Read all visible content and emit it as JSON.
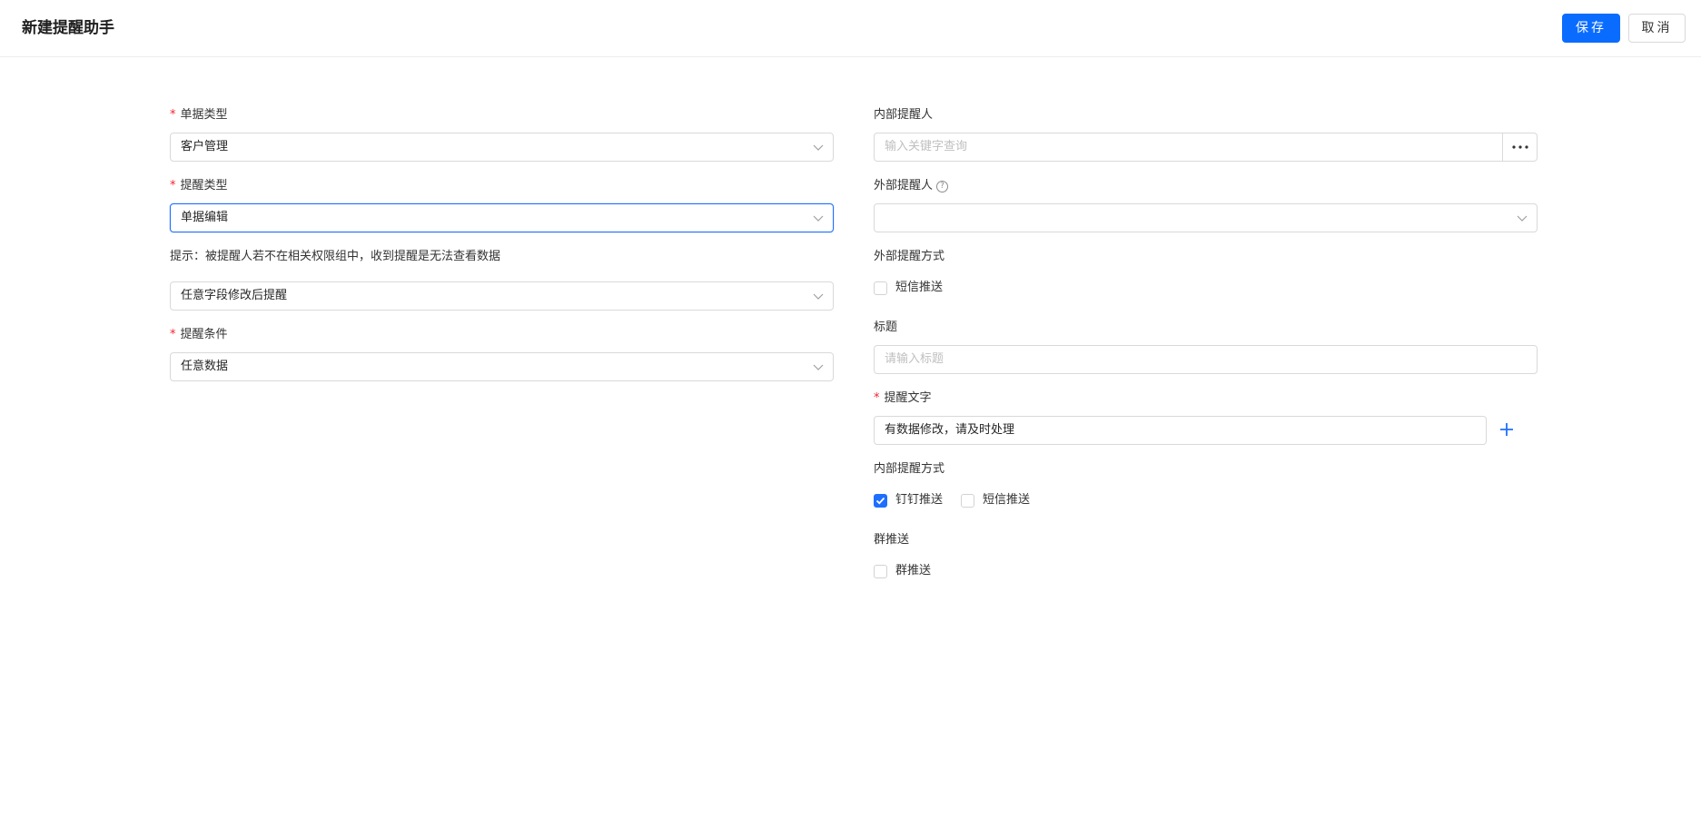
{
  "header": {
    "title": "新建提醒助手",
    "save_label": "保存",
    "cancel_label": "取消"
  },
  "left": {
    "doc_type": {
      "label": "单据类型",
      "required": "*",
      "value": "客户管理"
    },
    "remind_type": {
      "label": "提醒类型",
      "required": "*",
      "value": "单据编辑"
    },
    "hint": "提示：被提醒人若不在相关权限组中，收到提醒是无法查看数据",
    "trigger": {
      "value": "任意字段修改后提醒"
    },
    "condition": {
      "label": "提醒条件",
      "required": "*",
      "value": "任意数据"
    }
  },
  "right": {
    "internal_reminder": {
      "label": "内部提醒人",
      "placeholder": "输入关键字查询"
    },
    "external_reminder": {
      "label": "外部提醒人",
      "help": "?",
      "value": ""
    },
    "external_method": {
      "label": "外部提醒方式",
      "sms_label": "短信推送",
      "sms_checked": false
    },
    "title_field": {
      "label": "标题",
      "placeholder": "请输入标题"
    },
    "remind_text": {
      "label": "提醒文字",
      "required": "*",
      "value": "有数据修改，请及时处理"
    },
    "internal_method": {
      "label": "内部提醒方式",
      "dingtalk_label": "钉钉推送",
      "dingtalk_checked": true,
      "sms_label": "短信推送",
      "sms_checked": false
    },
    "group_push": {
      "label": "群推送",
      "option_label": "群推送",
      "checked": false
    }
  },
  "colors": {
    "primary": "#0a6cff",
    "required": "#f5222d",
    "border": "#d9d9d9",
    "focus_border": "#1f6fff"
  }
}
